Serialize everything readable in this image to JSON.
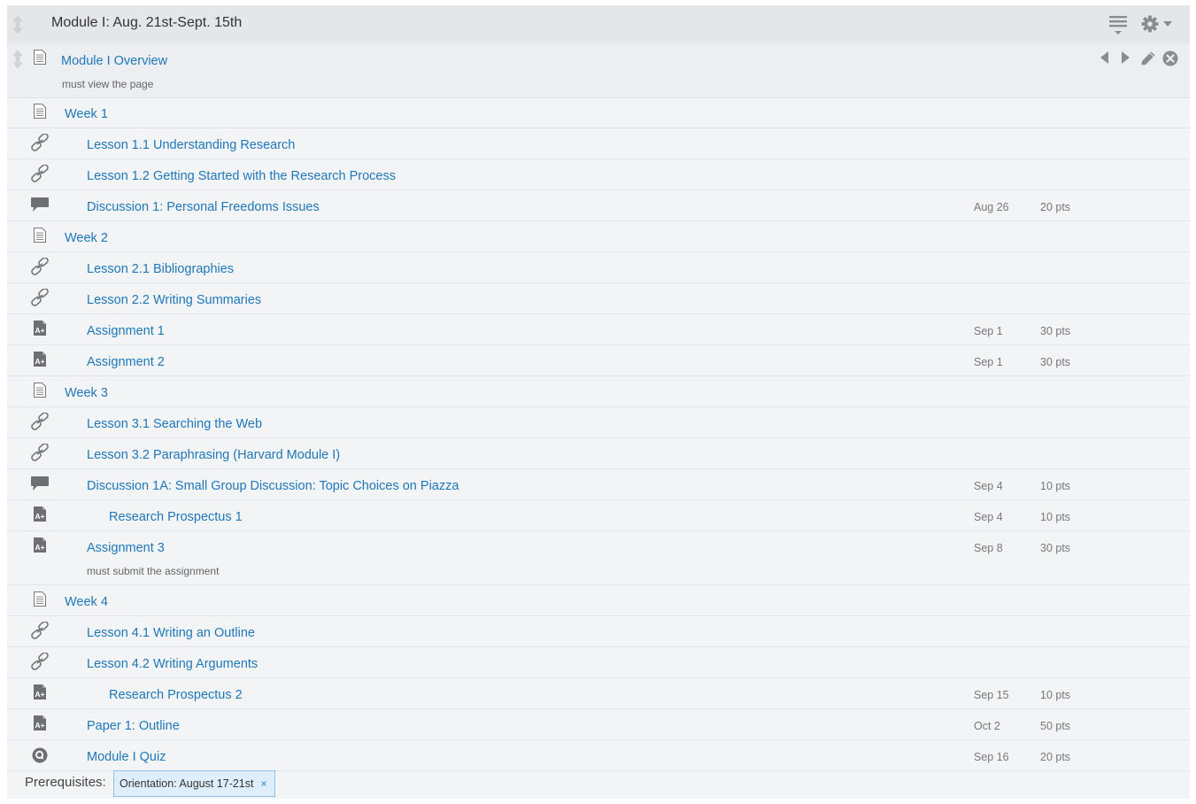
{
  "module": {
    "title": "Module I: Aug. 21st-Sept. 15th"
  },
  "overview": {
    "title": "Module I Overview",
    "requirement": "must view the page"
  },
  "items": [
    {
      "icon": "page",
      "title": "Week 1",
      "indent": 0,
      "due": "",
      "pts": "",
      "req": ""
    },
    {
      "icon": "link",
      "title": "Lesson 1.1 Understanding Research",
      "indent": 1,
      "due": "",
      "pts": "",
      "req": ""
    },
    {
      "icon": "link",
      "title": "Lesson 1.2 Getting Started with the Research Process",
      "indent": 1,
      "due": "",
      "pts": "",
      "req": ""
    },
    {
      "icon": "discussion",
      "title": "Discussion 1: Personal Freedoms Issues",
      "indent": 1,
      "due": "Aug 26",
      "pts": "20 pts",
      "req": ""
    },
    {
      "icon": "page",
      "title": "Week 2",
      "indent": 0,
      "due": "",
      "pts": "",
      "req": ""
    },
    {
      "icon": "link",
      "title": "Lesson 2.1 Bibliographies",
      "indent": 1,
      "due": "",
      "pts": "",
      "req": ""
    },
    {
      "icon": "link",
      "title": "Lesson 2.2 Writing Summaries",
      "indent": 1,
      "due": "",
      "pts": "",
      "req": ""
    },
    {
      "icon": "assignment",
      "title": "Assignment 1",
      "indent": 1,
      "due": "Sep 1",
      "pts": "30 pts",
      "req": ""
    },
    {
      "icon": "assignment",
      "title": "Assignment 2",
      "indent": 1,
      "due": "Sep 1",
      "pts": "30 pts",
      "req": ""
    },
    {
      "icon": "page",
      "title": "Week 3",
      "indent": 0,
      "due": "",
      "pts": "",
      "req": ""
    },
    {
      "icon": "link",
      "title": "Lesson 3.1 Searching the Web",
      "indent": 1,
      "due": "",
      "pts": "",
      "req": ""
    },
    {
      "icon": "link",
      "title": "Lesson 3.2 Paraphrasing (Harvard Module I)",
      "indent": 1,
      "due": "",
      "pts": "",
      "req": ""
    },
    {
      "icon": "discussion",
      "title": "Discussion 1A: Small Group Discussion: Topic Choices on Piazza",
      "indent": 1,
      "due": "Sep 4",
      "pts": "10 pts",
      "req": ""
    },
    {
      "icon": "assignment",
      "title": "Research Prospectus 1",
      "indent": 2,
      "due": "Sep 4",
      "pts": "10 pts",
      "req": ""
    },
    {
      "icon": "assignment",
      "title": "Assignment 3",
      "indent": 1,
      "due": "Sep 8",
      "pts": "30 pts",
      "req": "must submit the assignment"
    },
    {
      "icon": "page",
      "title": "Week 4",
      "indent": 0,
      "due": "",
      "pts": "",
      "req": ""
    },
    {
      "icon": "link",
      "title": "Lesson 4.1 Writing an Outline",
      "indent": 1,
      "due": "",
      "pts": "",
      "req": ""
    },
    {
      "icon": "link",
      "title": "Lesson 4.2 Writing Arguments",
      "indent": 1,
      "due": "",
      "pts": "",
      "req": ""
    },
    {
      "icon": "assignment",
      "title": "Research Prospectus 2",
      "indent": 2,
      "due": "Sep 15",
      "pts": "10 pts",
      "req": ""
    },
    {
      "icon": "assignment",
      "title": "Paper 1: Outline",
      "indent": 1,
      "due": "Oct 2",
      "pts": "50 pts",
      "req": ""
    },
    {
      "icon": "quiz",
      "title": "Module I Quiz",
      "indent": 1,
      "due": "Sep 16",
      "pts": "20 pts",
      "req": ""
    }
  ],
  "prerequisites": {
    "label": "Prerequisites:",
    "tag": "Orientation: August 17-21st",
    "remove": "×"
  }
}
